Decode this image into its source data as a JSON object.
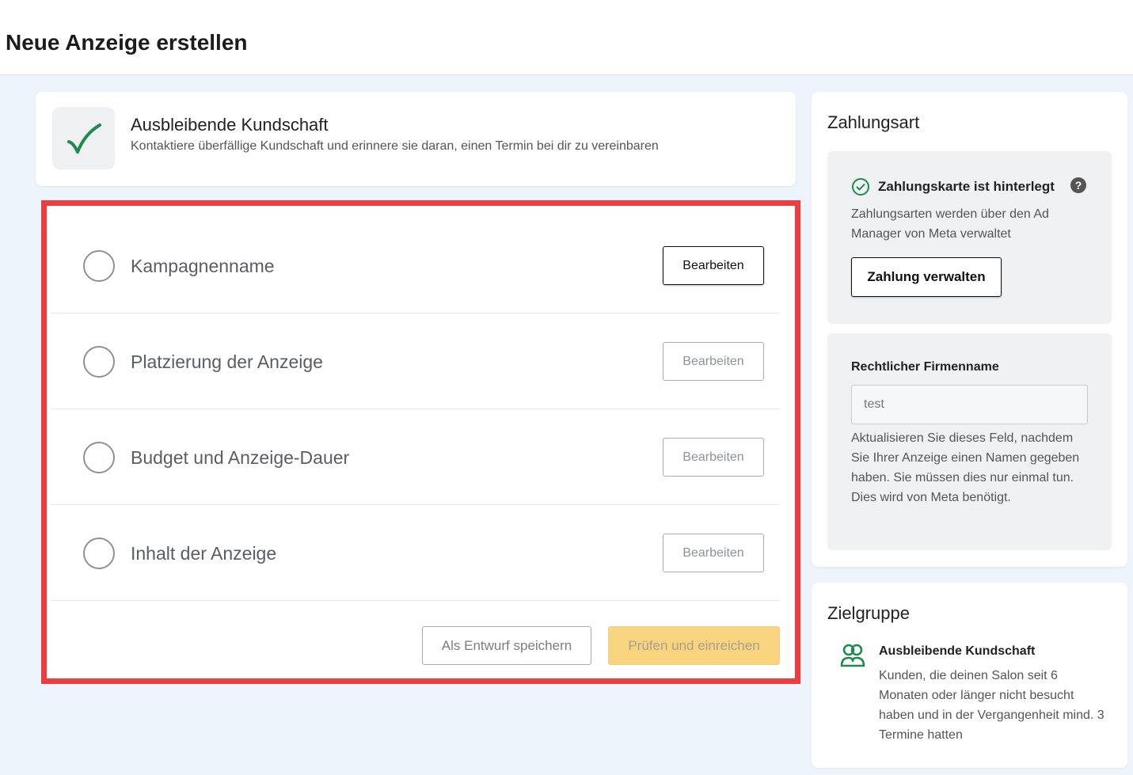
{
  "page": {
    "title": "Neue Anzeige erstellen"
  },
  "header_card": {
    "title": "Ausbleibende Kundschaft",
    "description": "Kontaktiere überfällige Kundschaft und erinnere sie daran, einen Termin bei dir zu vereinbaren",
    "icon": "checkmark-icon"
  },
  "steps": [
    {
      "label": "Kampagnenname",
      "button": "Bearbeiten",
      "enabled": true
    },
    {
      "label": "Platzierung der Anzeige",
      "button": "Bearbeiten",
      "enabled": false
    },
    {
      "label": "Budget und Anzeige-Dauer",
      "button": "Bearbeiten",
      "enabled": false
    },
    {
      "label": "Inhalt der Anzeige",
      "button": "Bearbeiten",
      "enabled": false
    }
  ],
  "footer": {
    "draft_label": "Als Entwurf speichern",
    "submit_label": "Prüfen und einreichen"
  },
  "payment": {
    "title": "Zahlungsart",
    "status": "Zahlungskarte ist hinterlegt",
    "help_icon": "?",
    "description": "Zahlungsarten werden über den Ad Manager von Meta verwaltet",
    "manage_label": "Zahlung verwalten"
  },
  "legal": {
    "label": "Rechtlicher Firmenname",
    "value": "test",
    "help": "Aktualisieren Sie dieses Feld, nachdem Sie Ihrer Anzeige einen Namen gegeben haben. Sie müssen dies nur einmal tun. Dies wird von Meta benötigt."
  },
  "audience": {
    "title": "Zielgruppe",
    "name": "Ausbleibende Kundschaft",
    "description": "Kunden, die deinen Salon seit 6 Monaten oder länger nicht besucht haben und in der Vergangenheit mind. 3 Termine hatten"
  },
  "colors": {
    "accent_green": "#1f8a4c",
    "highlight_red": "#ec3d3f",
    "submit_yellow": "#f7d47d"
  }
}
